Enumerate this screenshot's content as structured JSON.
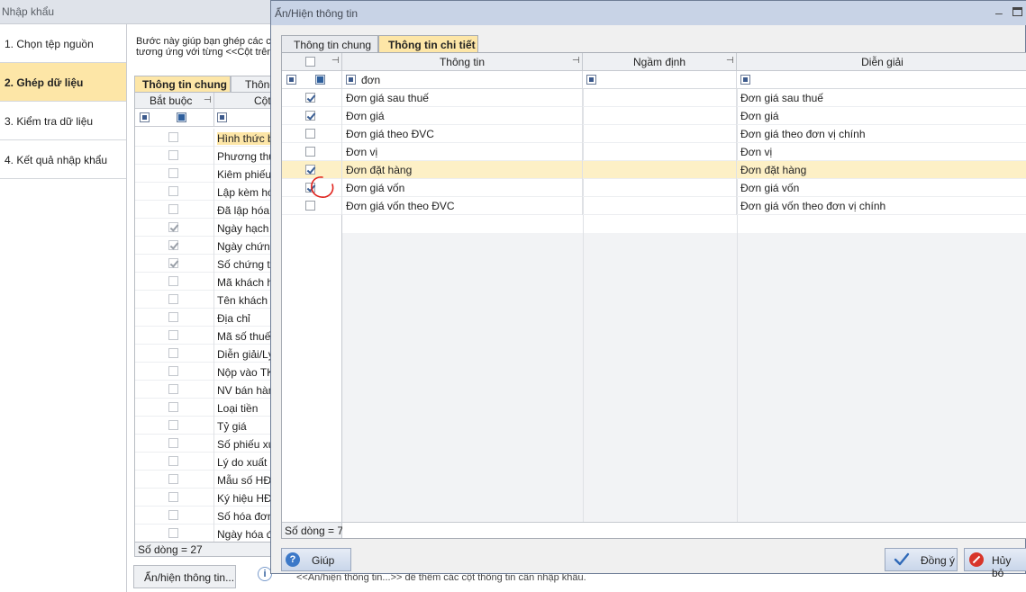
{
  "background_window": {
    "title": "Nhập khẩu",
    "wizard_steps": [
      {
        "label": "1. Chọn tệp nguồn",
        "active": false
      },
      {
        "label": "2. Ghép dữ liệu",
        "active": true
      },
      {
        "label": "3. Kiểm tra dữ liệu",
        "active": false
      },
      {
        "label": "4. Kết quả nhập khẩu",
        "active": false
      }
    ],
    "instruction_line1": "Bước này giúp bạn ghép các cột",
    "instruction_line2": "tương ứng với từng <<Cột trên p",
    "tabs": [
      {
        "label": "Thông tin chung",
        "selected": true
      },
      {
        "label": "Thông",
        "selected": false
      }
    ],
    "grid": {
      "col_required": "Bắt buộc",
      "col_column": "Cột",
      "rows": [
        {
          "label": "Hình thức bá",
          "checked": false,
          "highlight": true
        },
        {
          "label": "Phương thức",
          "checked": false,
          "highlight": false
        },
        {
          "label": "Kiêm phiếu x",
          "checked": false,
          "highlight": false
        },
        {
          "label": "Lập kèm hóa",
          "checked": false,
          "highlight": false
        },
        {
          "label": "Đã lập hóa đ",
          "checked": false,
          "highlight": false
        },
        {
          "label": "Ngày hạch t",
          "checked": true,
          "highlight": false
        },
        {
          "label": "Ngày chứng",
          "checked": true,
          "highlight": false
        },
        {
          "label": "Số chứng từ",
          "checked": true,
          "highlight": false
        },
        {
          "label": "Mã khách hà",
          "checked": false,
          "highlight": false
        },
        {
          "label": "Tên khách h",
          "checked": false,
          "highlight": false
        },
        {
          "label": "Địa chỉ",
          "checked": false,
          "highlight": false
        },
        {
          "label": "Mã số thuế",
          "checked": false,
          "highlight": false
        },
        {
          "label": "Diễn giải/Lý",
          "checked": false,
          "highlight": false
        },
        {
          "label": "Nộp vào TK",
          "checked": false,
          "highlight": false
        },
        {
          "label": "NV bán hàng",
          "checked": false,
          "highlight": false
        },
        {
          "label": "Loại tiền",
          "checked": false,
          "highlight": false
        },
        {
          "label": "Tỷ giá",
          "checked": false,
          "highlight": false
        },
        {
          "label": "Số phiếu xuấ",
          "checked": false,
          "highlight": false
        },
        {
          "label": "Lý do xuất",
          "checked": false,
          "highlight": false
        },
        {
          "label": "Mẫu số HĐ",
          "checked": false,
          "highlight": false
        },
        {
          "label": "Ký hiệu HĐ",
          "checked": false,
          "highlight": false
        },
        {
          "label": "Số hóa đơn",
          "checked": false,
          "highlight": false
        },
        {
          "label": "Ngày hóa đơ",
          "checked": false,
          "highlight": false
        }
      ],
      "row_count": "Số dòng = 27"
    },
    "show_hide_button": "Ẩn/hiện thông tin...",
    "hint_text": "<<Ẩn/hiện thông tin...>> để thêm các cột thông tin cần nhập khẩu."
  },
  "dialog": {
    "title": "Ẩn/Hiện thông tin",
    "tabs": [
      {
        "label": "Thông tin chung",
        "selected": false
      },
      {
        "label": "Thông tin chi tiết",
        "selected": true
      }
    ],
    "columns": {
      "info": "Thông tin",
      "default": "Ngầm định",
      "description": "Diễn giải"
    },
    "filter_text": "đơn",
    "rows": [
      {
        "checked": true,
        "info": "Đơn giá sau thuế",
        "default": "",
        "description": "Đơn giá sau thuế",
        "selected": false
      },
      {
        "checked": true,
        "info": "Đơn giá",
        "default": "",
        "description": "Đơn giá",
        "selected": false
      },
      {
        "checked": false,
        "info": "Đơn giá theo ĐVC",
        "default": "",
        "description": "Đơn giá theo đơn vị chính",
        "selected": false
      },
      {
        "checked": false,
        "info": "Đơn vị",
        "default": "",
        "description": "Đơn vị",
        "selected": false
      },
      {
        "checked": true,
        "info": "Đơn đặt hàng",
        "default": "",
        "description": "Đơn đặt hàng",
        "selected": true
      },
      {
        "checked": true,
        "info": "Đơn giá vốn",
        "default": "",
        "description": "Đơn giá vốn",
        "selected": false
      },
      {
        "checked": false,
        "info": "Đơn giá vốn theo ĐVC",
        "default": "",
        "description": "Đơn giá vốn theo đơn vị chính",
        "selected": false
      }
    ],
    "row_count": "Số dòng = 7",
    "buttons": {
      "help": "Giúp",
      "ok": "Đồng ý",
      "cancel": "Hủy bỏ"
    }
  },
  "colors": {
    "active_step": "#fde6a7",
    "selected_row": "#fdf0c6",
    "annotation_red": "#e0201a"
  }
}
